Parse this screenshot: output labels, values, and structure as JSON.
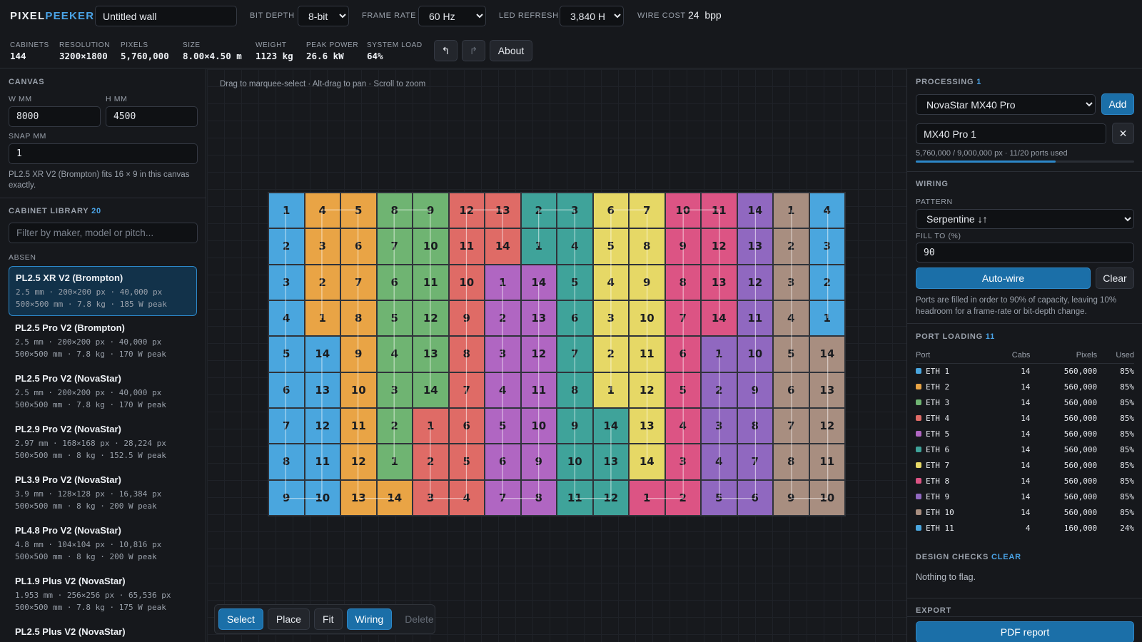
{
  "app": {
    "logo_a": "PIXEL",
    "logo_b": "PEEKER"
  },
  "header": {
    "wall_name": "Untitled wall",
    "bit_depth_label": "BIT DEPTH",
    "bit_depth": "8-bit",
    "frame_rate_label": "FRAME RATE",
    "frame_rate": "60 Hz",
    "led_refresh_label": "LED REFRESH",
    "led_refresh": "3,840 Hz",
    "wire_cost_label": "WIRE COST",
    "wire_cost_value": "24",
    "wire_cost_unit": "bpp"
  },
  "stats": [
    {
      "label": "CABINETS",
      "value": "144"
    },
    {
      "label": "RESOLUTION",
      "value": "3200×1800"
    },
    {
      "label": "PIXELS",
      "value": "5,760,000"
    },
    {
      "label": "SIZE",
      "value": "8.00×4.50 m"
    },
    {
      "label": "WEIGHT",
      "value": "1123 kg"
    },
    {
      "label": "PEAK POWER",
      "value": "26.6 kW"
    },
    {
      "label": "SYSTEM LOAD",
      "value": "64%"
    }
  ],
  "topbar": {
    "undo_glyph": "↰",
    "redo_glyph": "↱",
    "about": "About"
  },
  "canvas_panel": {
    "title": "CANVAS",
    "w_label": "W MM",
    "w_value": "8000",
    "h_label": "H MM",
    "h_value": "4500",
    "snap_label": "SNAP MM",
    "snap_value": "1",
    "fit_note": "PL2.5 XR V2 (Brompton) fits 16 × 9 in this canvas exactly."
  },
  "library": {
    "title": "CABINET LIBRARY",
    "count": "20",
    "filter_placeholder": "Filter by maker, model or pitch...",
    "group": "ABSEN",
    "items": [
      {
        "name": "PL2.5 XR V2 (Brompton)",
        "spec1": "2.5 mm · 200×200 px · 40,000 px",
        "spec2": "500×500 mm · 7.8 kg · 185 W peak"
      },
      {
        "name": "PL2.5 Pro V2 (Brompton)",
        "spec1": "2.5 mm · 200×200 px · 40,000 px",
        "spec2": "500×500 mm · 7.8 kg · 170 W peak"
      },
      {
        "name": "PL2.5 Pro V2 (NovaStar)",
        "spec1": "2.5 mm · 200×200 px · 40,000 px",
        "spec2": "500×500 mm · 7.8 kg · 170 W peak"
      },
      {
        "name": "PL2.9 Pro V2 (NovaStar)",
        "spec1": "2.97 mm · 168×168 px · 28,224 px",
        "spec2": "500×500 mm · 8 kg · 152.5 W peak"
      },
      {
        "name": "PL3.9 Pro V2 (NovaStar)",
        "spec1": "3.9 mm · 128×128 px · 16,384 px",
        "spec2": "500×500 mm · 8 kg · 200 W peak"
      },
      {
        "name": "PL4.8 Pro V2 (NovaStar)",
        "spec1": "4.8 mm · 104×104 px · 10,816 px",
        "spec2": "500×500 mm · 8 kg · 200 W peak"
      },
      {
        "name": "PL1.9 Plus V2 (NovaStar)",
        "spec1": "1.953 mm · 256×256 px · 65,536 px",
        "spec2": "500×500 mm · 7.8 kg · 175 W peak"
      },
      {
        "name": "PL2.5 Plus V2 (NovaStar)",
        "spec1": "",
        "spec2": ""
      }
    ]
  },
  "canvas": {
    "hint": "Drag to marquee-select · Alt-drag to pan · Scroll to zoom"
  },
  "toolbar": {
    "select": "Select",
    "place": "Place",
    "fit": "Fit",
    "wiring": "Wiring",
    "delete": "Delete"
  },
  "processing": {
    "title": "PROCESSING",
    "count": "1",
    "model": "NovaStar MX40 Pro",
    "add": "Add",
    "instance_name": "MX40 Pro 1",
    "remove_glyph": "✕",
    "usage": "5,760,000 / 9,000,000 px · 11/20 ports used",
    "usage_fraction": 0.64
  },
  "wiring": {
    "title": "WIRING",
    "pattern_label": "PATTERN",
    "pattern": "Serpentine ↓↑",
    "fill_label": "FILL TO (%)",
    "fill_value": "90",
    "auto_wire": "Auto-wire",
    "clear": "Clear",
    "note": "Ports are filled in order to 90% of capacity, leaving 10% headroom for a frame-rate or bit-depth change."
  },
  "port_loading": {
    "title": "PORT LOADING",
    "count": "11",
    "headers": [
      "Port",
      "Cabs",
      "Pixels",
      "Used"
    ],
    "rows": [
      {
        "port": "ETH 1",
        "cabs": "14",
        "pixels": "560,000",
        "used": "85%",
        "color": "#4aa6de"
      },
      {
        "port": "ETH 2",
        "cabs": "14",
        "pixels": "560,000",
        "used": "85%",
        "color": "#e9a445"
      },
      {
        "port": "ETH 3",
        "cabs": "14",
        "pixels": "560,000",
        "used": "85%",
        "color": "#6fb472"
      },
      {
        "port": "ETH 4",
        "cabs": "14",
        "pixels": "560,000",
        "used": "85%",
        "color": "#df6b66"
      },
      {
        "port": "ETH 5",
        "cabs": "14",
        "pixels": "560,000",
        "used": "85%",
        "color": "#b066c2"
      },
      {
        "port": "ETH 6",
        "cabs": "14",
        "pixels": "560,000",
        "used": "85%",
        "color": "#3fa39a"
      },
      {
        "port": "ETH 7",
        "cabs": "14",
        "pixels": "560,000",
        "used": "85%",
        "color": "#e6d866"
      },
      {
        "port": "ETH 8",
        "cabs": "14",
        "pixels": "560,000",
        "used": "85%",
        "color": "#dc5484"
      },
      {
        "port": "ETH 9",
        "cabs": "14",
        "pixels": "560,000",
        "used": "85%",
        "color": "#9068c0"
      },
      {
        "port": "ETH 10",
        "cabs": "14",
        "pixels": "560,000",
        "used": "85%",
        "color": "#a88e80"
      },
      {
        "port": "ETH 11",
        "cabs": "4",
        "pixels": "160,000",
        "used": "24%",
        "color": "#4aa6de"
      }
    ]
  },
  "design_checks": {
    "title": "DESIGN CHECKS",
    "status": "CLEAR",
    "message": "Nothing to flag."
  },
  "export": {
    "title": "EXPORT",
    "pdf": "PDF report"
  },
  "wall": {
    "columns": 16,
    "rows": 9,
    "port_colors": [
      "#4aa6de",
      "#e9a445",
      "#6fb472",
      "#df6b66",
      "#b066c2",
      "#3fa39a",
      "#e6d866",
      "#dc5484",
      "#9068c0",
      "#a88e80",
      "#4aa6de"
    ],
    "cells": [
      [
        0,
        1
      ],
      [
        1,
        4
      ],
      [
        1,
        5
      ],
      [
        2,
        8
      ],
      [
        2,
        9
      ],
      [
        3,
        12
      ],
      [
        3,
        13
      ],
      [
        5,
        2
      ],
      [
        5,
        3
      ],
      [
        6,
        6
      ],
      [
        6,
        7
      ],
      [
        7,
        10
      ],
      [
        7,
        11
      ],
      [
        8,
        14
      ],
      [
        9,
        1
      ],
      [
        10,
        4
      ],
      [
        0,
        2
      ],
      [
        1,
        3
      ],
      [
        1,
        6
      ],
      [
        2,
        7
      ],
      [
        2,
        10
      ],
      [
        3,
        11
      ],
      [
        3,
        14
      ],
      [
        5,
        1
      ],
      [
        5,
        4
      ],
      [
        6,
        5
      ],
      [
        6,
        8
      ],
      [
        7,
        9
      ],
      [
        7,
        12
      ],
      [
        8,
        13
      ],
      [
        9,
        2
      ],
      [
        10,
        3
      ],
      [
        0,
        3
      ],
      [
        1,
        2
      ],
      [
        1,
        7
      ],
      [
        2,
        6
      ],
      [
        2,
        11
      ],
      [
        3,
        10
      ],
      [
        4,
        1
      ],
      [
        4,
        14
      ],
      [
        5,
        5
      ],
      [
        6,
        4
      ],
      [
        6,
        9
      ],
      [
        7,
        8
      ],
      [
        7,
        13
      ],
      [
        8,
        12
      ],
      [
        9,
        3
      ],
      [
        10,
        2
      ],
      [
        0,
        4
      ],
      [
        1,
        1
      ],
      [
        1,
        8
      ],
      [
        2,
        5
      ],
      [
        2,
        12
      ],
      [
        3,
        9
      ],
      [
        4,
        2
      ],
      [
        4,
        13
      ],
      [
        5,
        6
      ],
      [
        6,
        3
      ],
      [
        6,
        10
      ],
      [
        7,
        7
      ],
      [
        7,
        14
      ],
      [
        8,
        11
      ],
      [
        9,
        4
      ],
      [
        10,
        1
      ],
      [
        0,
        5
      ],
      [
        0,
        14
      ],
      [
        1,
        9
      ],
      [
        2,
        4
      ],
      [
        2,
        13
      ],
      [
        3,
        8
      ],
      [
        4,
        3
      ],
      [
        4,
        12
      ],
      [
        5,
        7
      ],
      [
        6,
        2
      ],
      [
        6,
        11
      ],
      [
        7,
        6
      ],
      [
        8,
        1
      ],
      [
        8,
        10
      ],
      [
        9,
        5
      ],
      [
        9,
        14
      ],
      [
        0,
        6
      ],
      [
        0,
        13
      ],
      [
        1,
        10
      ],
      [
        2,
        3
      ],
      [
        2,
        14
      ],
      [
        3,
        7
      ],
      [
        4,
        4
      ],
      [
        4,
        11
      ],
      [
        5,
        8
      ],
      [
        6,
        1
      ],
      [
        6,
        12
      ],
      [
        7,
        5
      ],
      [
        8,
        2
      ],
      [
        8,
        9
      ],
      [
        9,
        6
      ],
      [
        9,
        13
      ],
      [
        0,
        7
      ],
      [
        0,
        12
      ],
      [
        1,
        11
      ],
      [
        2,
        2
      ],
      [
        3,
        1
      ],
      [
        3,
        6
      ],
      [
        4,
        5
      ],
      [
        4,
        10
      ],
      [
        5,
        9
      ],
      [
        5,
        14
      ],
      [
        6,
        13
      ],
      [
        7,
        4
      ],
      [
        8,
        3
      ],
      [
        8,
        8
      ],
      [
        9,
        7
      ],
      [
        9,
        12
      ],
      [
        0,
        8
      ],
      [
        0,
        11
      ],
      [
        1,
        12
      ],
      [
        2,
        1
      ],
      [
        3,
        2
      ],
      [
        3,
        5
      ],
      [
        4,
        6
      ],
      [
        4,
        9
      ],
      [
        5,
        10
      ],
      [
        5,
        13
      ],
      [
        6,
        14
      ],
      [
        7,
        3
      ],
      [
        8,
        4
      ],
      [
        8,
        7
      ],
      [
        9,
        8
      ],
      [
        9,
        11
      ],
      [
        0,
        9
      ],
      [
        0,
        10
      ],
      [
        1,
        13
      ],
      [
        1,
        14
      ],
      [
        3,
        3
      ],
      [
        3,
        4
      ],
      [
        4,
        7
      ],
      [
        4,
        8
      ],
      [
        5,
        11
      ],
      [
        5,
        12
      ],
      [
        7,
        1
      ],
      [
        7,
        2
      ],
      [
        8,
        5
      ],
      [
        8,
        6
      ],
      [
        9,
        9
      ],
      [
        9,
        10
      ]
    ]
  }
}
